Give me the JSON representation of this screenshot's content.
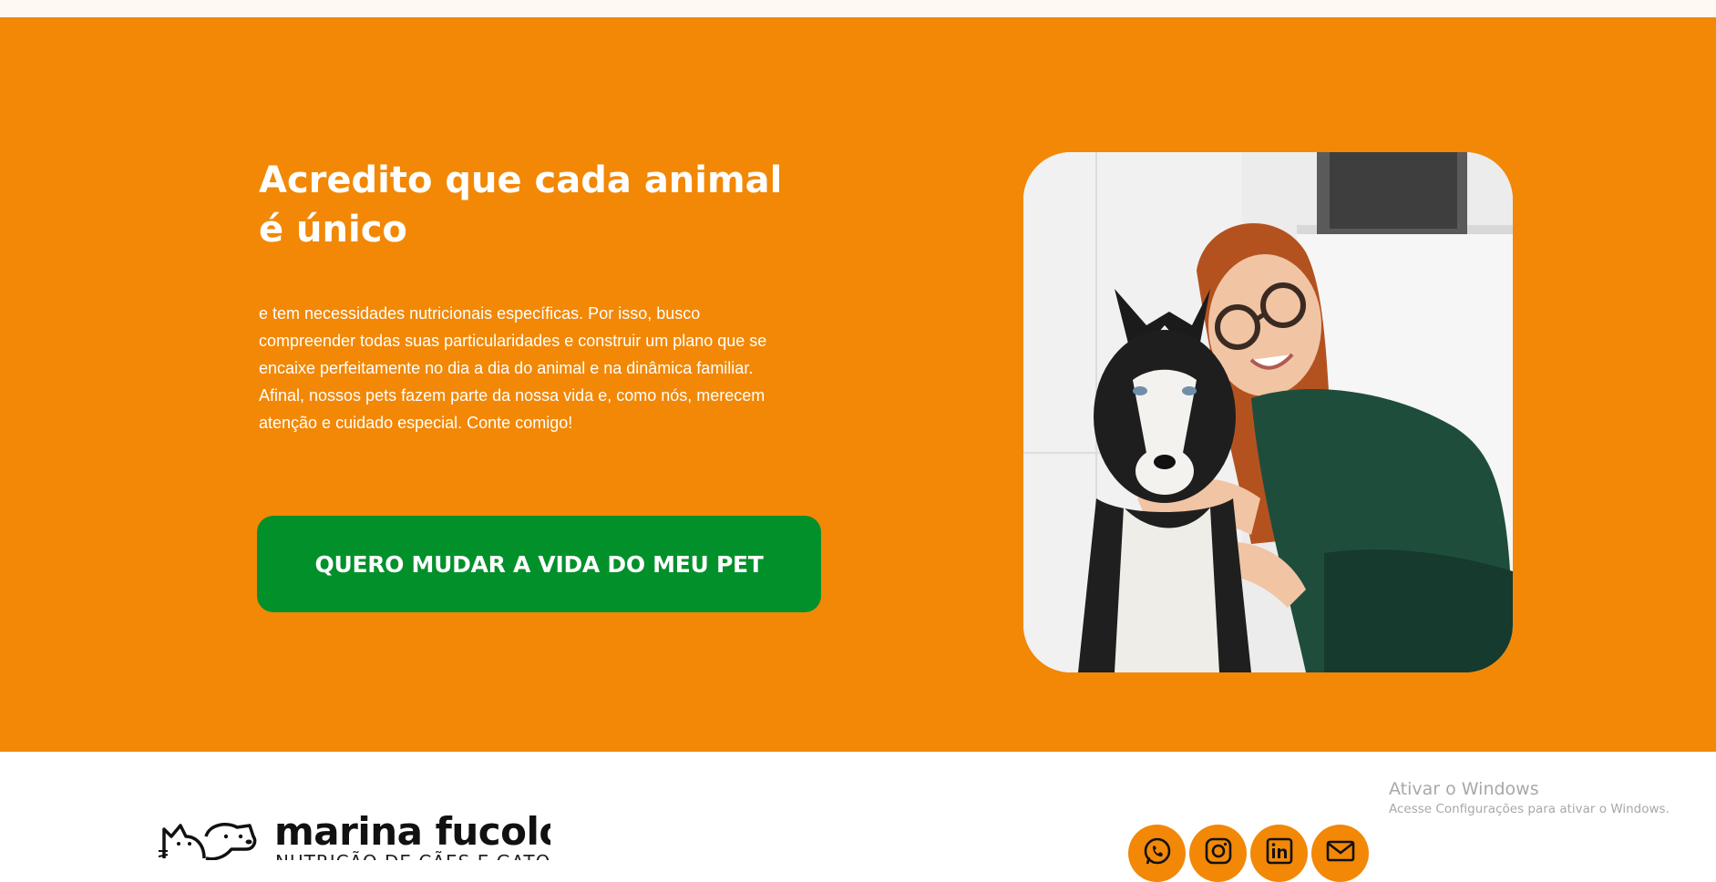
{
  "hero": {
    "title_line1": "Acredito que cada animal",
    "title_line2": "é único",
    "body": "e tem necessidades nutricionais específicas. Por isso, busco compreender todas suas particularidades e construir um plano que se encaixe perfeitamente no dia a dia do animal e na dinâmica familiar. Afinal, nossos pets fazem parte da nossa vida e, como nós, merecem atenção e cuidado especial. Conte comigo!",
    "cta_label": "QUERO MUDAR A VIDA DO MEU PET",
    "background_color": "#f28806",
    "cta_color": "#02902b"
  },
  "footer": {
    "brand_name": "marina fucolo",
    "brand_tagline": "NUTRIÇÃO DE CÃES E GATOS",
    "socials": [
      {
        "icon": "whatsapp-icon"
      },
      {
        "icon": "instagram-icon"
      },
      {
        "icon": "linkedin-icon"
      },
      {
        "icon": "email-icon"
      }
    ]
  },
  "os_watermark": {
    "title": "Ativar o Windows",
    "subtitle": "Acesse Configurações para ativar o Windows."
  }
}
